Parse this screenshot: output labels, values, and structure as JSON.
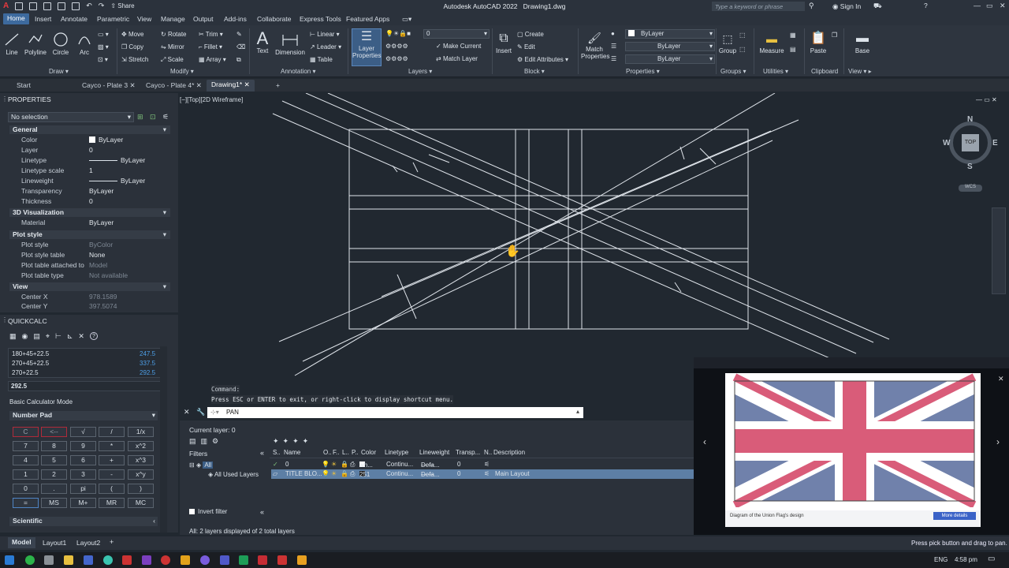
{
  "titlebar": {
    "app_title": "Autodesk AutoCAD 2022",
    "doc_title": "Drawing1.dwg",
    "share_label": "Share",
    "search_placeholder": "Type a keyword or phrase",
    "signin_label": "Sign In"
  },
  "menu_tabs": [
    "Home",
    "Insert",
    "Annotate",
    "Parametric",
    "View",
    "Manage",
    "Output",
    "Add-ins",
    "Collaborate",
    "Express Tools",
    "Featured Apps"
  ],
  "ribbon": {
    "draw": {
      "line": "Line",
      "polyline": "Polyline",
      "circle": "Circle",
      "arc": "Arc",
      "panel": "Draw"
    },
    "modify": {
      "move": "Move",
      "rotate": "Rotate",
      "trim": "Trim",
      "copy": "Copy",
      "mirror": "Mirror",
      "fillet": "Fillet",
      "stretch": "Stretch",
      "scale": "Scale",
      "array": "Array",
      "panel": "Modify"
    },
    "annotation": {
      "text": "Text",
      "dimension": "Dimension",
      "linear": "Linear",
      "leader": "Leader",
      "table": "Table",
      "panel": "Annotation"
    },
    "layers": {
      "layer_properties": "Layer Properties",
      "current": "0",
      "make_current": "Make Current",
      "match_layer": "Match Layer",
      "panel": "Layers"
    },
    "block": {
      "insert": "Insert",
      "create": "Create",
      "edit": "Edit",
      "edit_attributes": "Edit Attributes",
      "panel": "Block"
    },
    "properties": {
      "match_properties": "Match Properties",
      "color": "ByLayer",
      "linetype": "ByLayer",
      "lineweight": "ByLayer",
      "panel": "Properties"
    },
    "groups": {
      "group": "Group",
      "panel": "Groups"
    },
    "utilities": {
      "measure": "Measure",
      "panel": "Utilities"
    },
    "clipboard": {
      "paste": "Paste",
      "panel": "Clipboard"
    },
    "view": {
      "base": "Base",
      "panel": "View"
    }
  },
  "doc_tabs": [
    "Start",
    "Cayco - Plate 3",
    "Cayco - Plate 4*",
    "Drawing1*"
  ],
  "viewport_label": "[−][Top][2D Wireframe]",
  "viewcube": {
    "n": "N",
    "s": "S",
    "e": "E",
    "w": "W",
    "top": "TOP",
    "wcs": "WCS"
  },
  "properties": {
    "title": "PROPERTIES",
    "selection": "No selection",
    "general": {
      "title": "General",
      "rows": [
        {
          "k": "Color",
          "v": "ByLayer"
        },
        {
          "k": "Layer",
          "v": "0"
        },
        {
          "k": "Linetype",
          "v": "ByLayer"
        },
        {
          "k": "Linetype scale",
          "v": "1"
        },
        {
          "k": "Lineweight",
          "v": "ByLayer"
        },
        {
          "k": "Transparency",
          "v": "ByLayer"
        },
        {
          "k": "Thickness",
          "v": "0"
        }
      ]
    },
    "viz": {
      "title": "3D Visualization",
      "rows": [
        {
          "k": "Material",
          "v": "ByLayer"
        }
      ]
    },
    "plot": {
      "title": "Plot style",
      "rows": [
        {
          "k": "Plot style",
          "v": "ByColor"
        },
        {
          "k": "Plot style table",
          "v": "None"
        },
        {
          "k": "Plot table attached to",
          "v": "Model"
        },
        {
          "k": "Plot table type",
          "v": "Not available"
        }
      ]
    },
    "view": {
      "title": "View",
      "rows": [
        {
          "k": "Center X",
          "v": "978.1589"
        },
        {
          "k": "Center Y",
          "v": "397.5074"
        }
      ]
    }
  },
  "quickcalc": {
    "title": "QUICKCALC",
    "history": [
      {
        "expr": "180+45+22.5",
        "res": "247.5"
      },
      {
        "expr": "270+45+22.5",
        "res": "337.5"
      },
      {
        "expr": "270+22.5",
        "res": "292.5"
      }
    ],
    "input": "292.5",
    "mode": "Basic Calculator Mode",
    "numpad_title": "Number Pad",
    "keys": [
      [
        "C",
        "<--",
        "√",
        "/",
        "1/x"
      ],
      [
        "7",
        "8",
        "9",
        "*",
        "x^2"
      ],
      [
        "4",
        "5",
        "6",
        "+",
        "x^3"
      ],
      [
        "1",
        "2",
        "3",
        "-",
        "x^y"
      ],
      [
        "0",
        ".",
        "pi",
        "(",
        ")"
      ],
      [
        "=",
        "MS",
        "M+",
        "MR",
        "MC"
      ]
    ],
    "scientific": "Scientific"
  },
  "command": {
    "history_1": "Command:",
    "history_2": "Press ESC or ENTER to exit, or right-click to display shortcut menu.",
    "current": "PAN"
  },
  "layers_panel": {
    "current_layer": "Current layer: 0",
    "filters": "Filters",
    "all": "All",
    "all_used": "All Used Layers",
    "invert_filter": "Invert filter",
    "status": "All: 2 layers displayed of 2 total layers",
    "headers": [
      "S..",
      "Name",
      "O..",
      "F..",
      "L..",
      "P..",
      "Color",
      "Linetype",
      "Lineweight",
      "Transp...",
      "N..",
      "Description"
    ],
    "rows": [
      {
        "name": "0",
        "color": "wh...",
        "linetype": "Continu...",
        "lineweight": "Defa...",
        "transp": "0",
        "desc": ""
      },
      {
        "name": "TITLE BLO...",
        "color": "251",
        "linetype": "Continu...",
        "lineweight": "Defa...",
        "transp": "0",
        "desc": "Main Layout"
      }
    ]
  },
  "video": {
    "caption": "Diagram of the Union Flag's design",
    "more_details": "More details"
  },
  "layout_tabs": [
    "Model",
    "Layout1",
    "Layout2"
  ],
  "status_hint": "Press pick button and drag to pan.",
  "taskbar": {
    "lang": "ENG",
    "time": "4:58 pm"
  }
}
